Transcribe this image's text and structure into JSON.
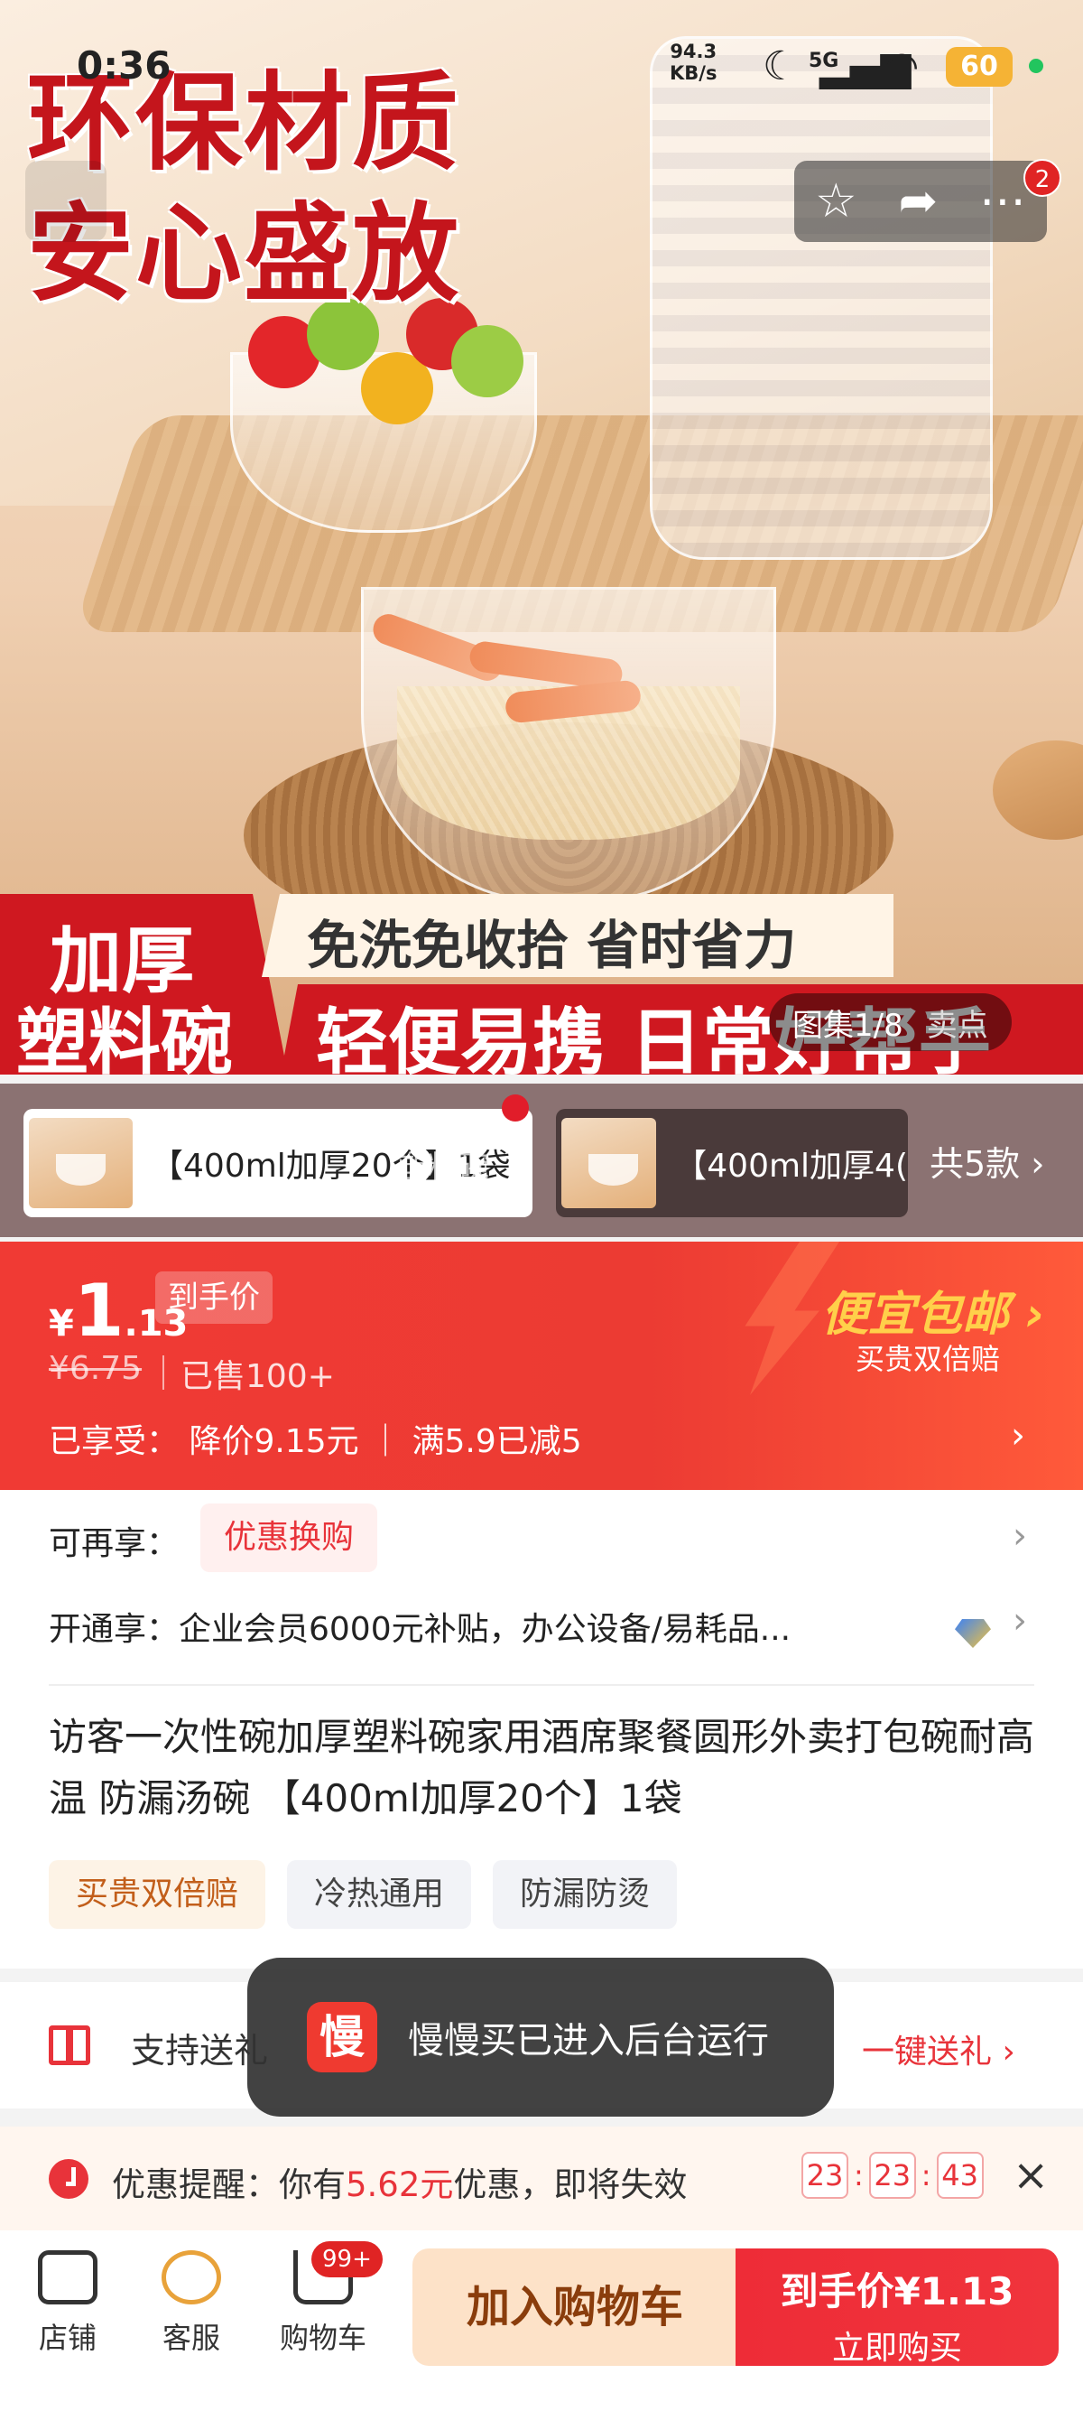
{
  "status_bar": {
    "time": "0:36",
    "net_speed_value": "94.3",
    "net_speed_unit": "KB/s",
    "network": "5G",
    "battery": "60"
  },
  "hero": {
    "title_line1": "环保材质",
    "title_line2": "安心盛放",
    "banner_left_line1": "加厚",
    "banner_left_line2": "塑料碗",
    "banner_slogan1": "免洗免收拾 省时省力",
    "banner_slogan2": "轻便易携 日常好帮手",
    "gallery_label": "图集1/8",
    "gallery_extra": "卖点",
    "notification_count": "2"
  },
  "variants": {
    "active_label": "【400ml加厚20个】1袋",
    "other_label": "【400ml加厚4(",
    "ghost_text": "塑料碗",
    "total_label": "共5款 ›"
  },
  "price": {
    "currency": "¥",
    "integer": "1",
    "decimal": ".13",
    "tag": "到手价",
    "original": "¥6.75",
    "sold": "已售100+",
    "enjoyed": "已享受：  降价9.15元 ｜ 满5.9已减5",
    "promo_title": "便宜包邮 ›",
    "promo_sub": "买贵双倍赔"
  },
  "info": {
    "more_label": "可再享：",
    "more_chip": "优惠换购",
    "member_text": "开通享：企业会员6000元补贴，办公设备/易耗品...",
    "product_title": "访客一次性碗加厚塑料碗家用酒席聚餐圆形外卖打包碗耐高温 防漏汤碗 【400ml加厚20个】1袋",
    "tags": [
      "买贵双倍赔",
      "冷热通用",
      "防漏防烫"
    ]
  },
  "gift": {
    "text": "支持送礼",
    "link": "一键送礼 ›"
  },
  "reminder": {
    "prefix": "优惠提醒：你有",
    "amount": "5.62元",
    "suffix": "优惠，即将失效",
    "hh": "23",
    "mm": "23",
    "ss": "43"
  },
  "bottom_bar": {
    "shop": "店铺",
    "service": "客服",
    "cart": "购物车",
    "cart_badge": "99+",
    "add_to_cart": "加入购物车",
    "buy_line1": "到手价¥1.13",
    "buy_line2": "立即购买"
  },
  "toast": {
    "logo": "慢",
    "text": "慢慢买已进入后台运行"
  },
  "colors": {
    "accent_red": "#e8333a",
    "price_bg": "#f03a34",
    "cart_button_bg": "#fde2c8"
  }
}
